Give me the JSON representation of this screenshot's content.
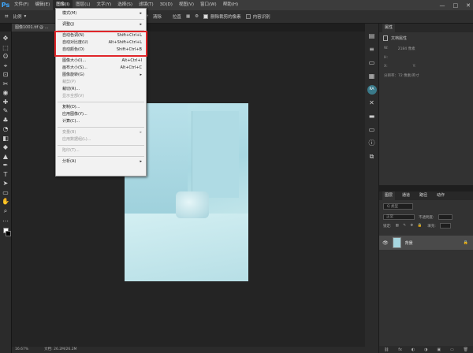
{
  "app": {
    "logo": "Ps"
  },
  "menubar": {
    "items": [
      "文件(F)",
      "编辑(E)",
      "图像(I)",
      "图层(L)",
      "文字(Y)",
      "选择(S)",
      "滤镜(T)",
      "3D(D)",
      "视图(V)",
      "窗口(W)",
      "帮助(H)"
    ],
    "active_index": 2
  },
  "window_controls": {
    "minimize": "—",
    "maximize": "□",
    "close": "✕"
  },
  "options": {
    "ratio_label": "比例",
    "swap_icon": "⇄",
    "clear_label": "清除",
    "straighten_label": "拉直",
    "grid_icon": "▦",
    "settings_icon": "⚙",
    "delete_cropped": "删除裁剪的像素",
    "content_aware": "内容识别"
  },
  "document_tab": {
    "title": "图像1001.tif @ ..."
  },
  "image_menu": {
    "items": [
      {
        "label": "模式(M)",
        "shortcut": "",
        "submenu": true,
        "disabled": false
      },
      {
        "sep": true
      },
      {
        "label": "调整(J)",
        "shortcut": "",
        "submenu": true,
        "disabled": false
      },
      {
        "sep": true
      },
      {
        "label": "自动色调(N)",
        "shortcut": "Shift+Ctrl+L",
        "submenu": false,
        "disabled": false
      },
      {
        "label": "自动对比度(U)",
        "shortcut": "Alt+Shift+Ctrl+L",
        "submenu": false,
        "disabled": false
      },
      {
        "label": "自动颜色(O)",
        "shortcut": "Shift+Ctrl+B",
        "submenu": false,
        "disabled": false
      },
      {
        "sep": true
      },
      {
        "label": "图像大小(I)...",
        "shortcut": "Alt+Ctrl+I",
        "submenu": false,
        "disabled": false
      },
      {
        "label": "画布大小(S)...",
        "shortcut": "Alt+Ctrl+C",
        "submenu": false,
        "disabled": false
      },
      {
        "label": "图像旋转(G)",
        "shortcut": "",
        "submenu": true,
        "disabled": false
      },
      {
        "label": "裁剪(P)",
        "shortcut": "",
        "submenu": false,
        "disabled": true
      },
      {
        "label": "裁切(R)...",
        "shortcut": "",
        "submenu": false,
        "disabled": false
      },
      {
        "label": "显示全部(V)",
        "shortcut": "",
        "submenu": false,
        "disabled": true
      },
      {
        "sep": true
      },
      {
        "label": "复制(D)...",
        "shortcut": "",
        "submenu": false,
        "disabled": false
      },
      {
        "label": "应用图像(Y)...",
        "shortcut": "",
        "submenu": false,
        "disabled": false
      },
      {
        "label": "计算(C)...",
        "shortcut": "",
        "submenu": false,
        "disabled": false
      },
      {
        "sep": true
      },
      {
        "label": "变量(B)",
        "shortcut": "",
        "submenu": true,
        "disabled": true
      },
      {
        "label": "应用数据组(L)...",
        "shortcut": "",
        "submenu": false,
        "disabled": true
      },
      {
        "sep": true
      },
      {
        "label": "陷印(T)...",
        "shortcut": "",
        "submenu": false,
        "disabled": true
      },
      {
        "sep": true
      },
      {
        "label": "分析(A)",
        "shortcut": "",
        "submenu": true,
        "disabled": false
      }
    ]
  },
  "toolbar": {
    "tools": [
      "✥",
      "⬚",
      "ʘ",
      "⌖",
      "⊡",
      "✂",
      "◉",
      "✚",
      "✎",
      "♣",
      "◔",
      "◧",
      "◆",
      "▲",
      "✒",
      "T",
      "➤",
      "▭",
      "✋",
      "⌕",
      "…"
    ]
  },
  "right_icons": [
    "▤",
    "≡",
    "▭",
    "▦",
    "RA",
    "✕",
    "▬",
    "▭",
    "ⓘ",
    "⧉"
  ],
  "properties": {
    "tab_label": "属性",
    "doc_label": "文档属性",
    "w_label": "W:",
    "w_value": "2184 像素",
    "h_label": "H:",
    "x_label": "X:",
    "y_label": "Y:",
    "resolution_label": "分辨率：72 像素/英寸"
  },
  "layers": {
    "tabs": [
      "图层",
      "通道",
      "路径",
      "动作"
    ],
    "kind_filter": "Q 类型",
    "blend_mode": "正常",
    "opacity_label": "不透明度:",
    "lock_label": "锁定:",
    "fill_label": "填充:",
    "layer_name": "背景",
    "footer_icons": [
      "⛓",
      "fx",
      "◐",
      "◑",
      "▣",
      "▭",
      "🗑"
    ]
  },
  "status": {
    "zoom": "16.67%",
    "doc_info": "文档: 26.2M/26.2M"
  }
}
